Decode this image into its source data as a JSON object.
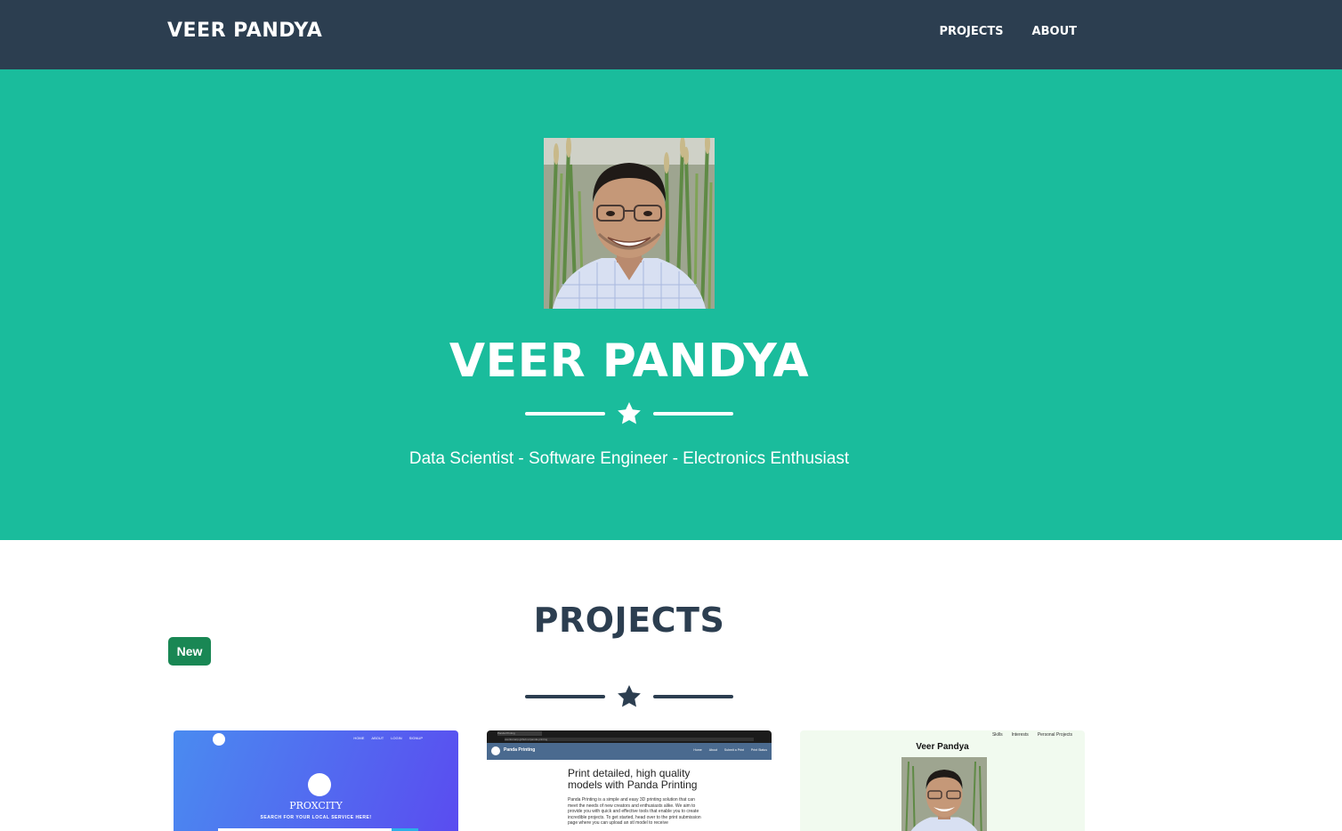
{
  "nav": {
    "brand": "VEER PANDYA",
    "links": [
      "PROJECTS",
      "ABOUT"
    ]
  },
  "hero": {
    "title": "VEER PANDYA",
    "subtitle": "Data Scientist - Software Engineer - Electronics Enthusiast",
    "avatar_alt": "Portrait of Veer Pandya"
  },
  "projects": {
    "title": "PROJECTS",
    "badge": "New",
    "cards": [
      {
        "name": "PROXCITY",
        "tagline": "SEARCH FOR YOUR LOCAL SERVICE HERE!",
        "nav": [
          "HOME",
          "ABOUT",
          "LOGIN",
          "SIGNUP"
        ]
      },
      {
        "tab_title": "Panda Printing",
        "url": "veerkumarp.github.io/panda-printing",
        "brand": "Panda Printing",
        "nav": [
          "Home",
          "About",
          "Submit a Print",
          "Print Status"
        ],
        "headline": "Print detailed, high quality models with Panda Printing",
        "body": "Panda Printing is a simple and easy 3D printing solution that can meet the needs of new creators and enthusiasts alike. We aim to provide you with quick and effective tools that enable you to create incredible projects. To get started, head over to the print submission page where you can upload an stl model to receive"
      },
      {
        "name": "Veer Pandya",
        "nav": [
          "Skills",
          "Interests",
          "Personal Projects"
        ]
      }
    ]
  },
  "colors": {
    "navbar": "#2c3e50",
    "primary": "#1abc9c",
    "badge": "#198754",
    "dark_text": "#2c3e50"
  },
  "icons": {
    "divider": "star-icon"
  }
}
